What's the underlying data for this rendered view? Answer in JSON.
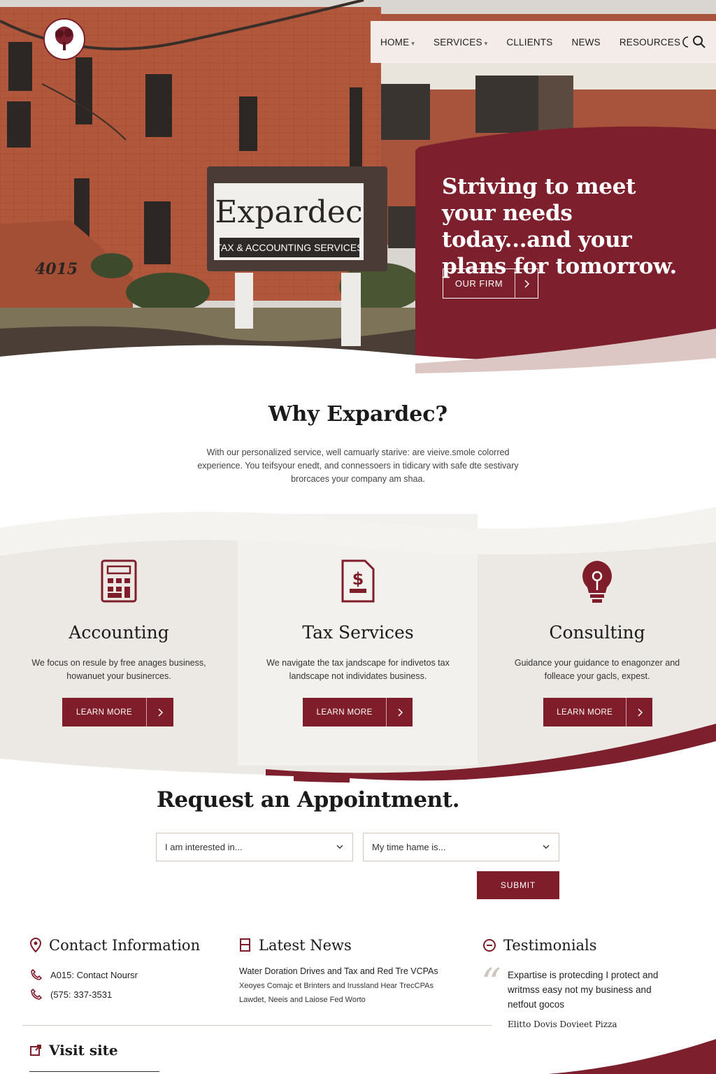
{
  "nav": {
    "items": [
      {
        "label": "HOME",
        "caret": "▾"
      },
      {
        "label": "SERVICES",
        "caret": "▾"
      },
      {
        "label": "CLLIENTS"
      },
      {
        "label": "NEWS"
      },
      {
        "label": "RESOURCES"
      }
    ],
    "icons": [
      "moon-icon",
      "search-icon"
    ]
  },
  "hero": {
    "sign_name": "Expardec",
    "sign_subtitle": "TAX & ACCOUNTING SERVICES",
    "address_number": "4015",
    "headline": "Striving to meet your needs today...and your plans for tomorrow.",
    "cta_label": "OUR FIRM"
  },
  "why": {
    "title": "Why Expardec?",
    "text": "With our personalized service, well camuarly starive: are vieive.smole colorred experience. You teifsyour enedt, and connessoers in tidicary with safe dte sestivary brorcaces your company am shaa."
  },
  "services": [
    {
      "title": "Accounting",
      "text": "We focus on resule by free anages business, howanuet your businerces.",
      "button": "LEARN MORE",
      "icon": "calculator-icon"
    },
    {
      "title": "Tax Services",
      "text": "We navigate the tax jandscape for indivetos tax landscape not individates business.",
      "button": "LEARN MORE",
      "icon": "tax-document-icon"
    },
    {
      "title": "Consulting",
      "text": "Guidance your guidance to enagonzer and folleace your gacls, expest.",
      "button": "LEARN MORE",
      "icon": "lightbulb-icon"
    }
  ],
  "appointment": {
    "title": "Request an Appointment.",
    "interest_placeholder": "I am interested in...",
    "time_placeholder": "My time hame is...",
    "submit": "SUBMIT"
  },
  "contact": {
    "title": "Contact Information",
    "address": "A015: Contact Noursr",
    "phone": "(575: 337-3531"
  },
  "news": {
    "title": "Latest News",
    "lines": [
      "Water Doration Drives and Tax and Red Tre VCPAs",
      "Xeoyes Comajc et Brinters and Irussland Hear TrecCPAs",
      "Lawdet, Neeis and Laiose Fed Worto"
    ]
  },
  "testimonials": {
    "title": "Testimonials",
    "quote": "Expartise is protecding I protect and writmss easy not my business and netfout gocos",
    "author": "Elitto Dovis Dovieet Pizza"
  },
  "visit": {
    "label": "Visit site"
  },
  "colors": {
    "brand": "#7f1d2a",
    "panel": "#7d1f2c",
    "light_bg": "#ece9e5"
  }
}
